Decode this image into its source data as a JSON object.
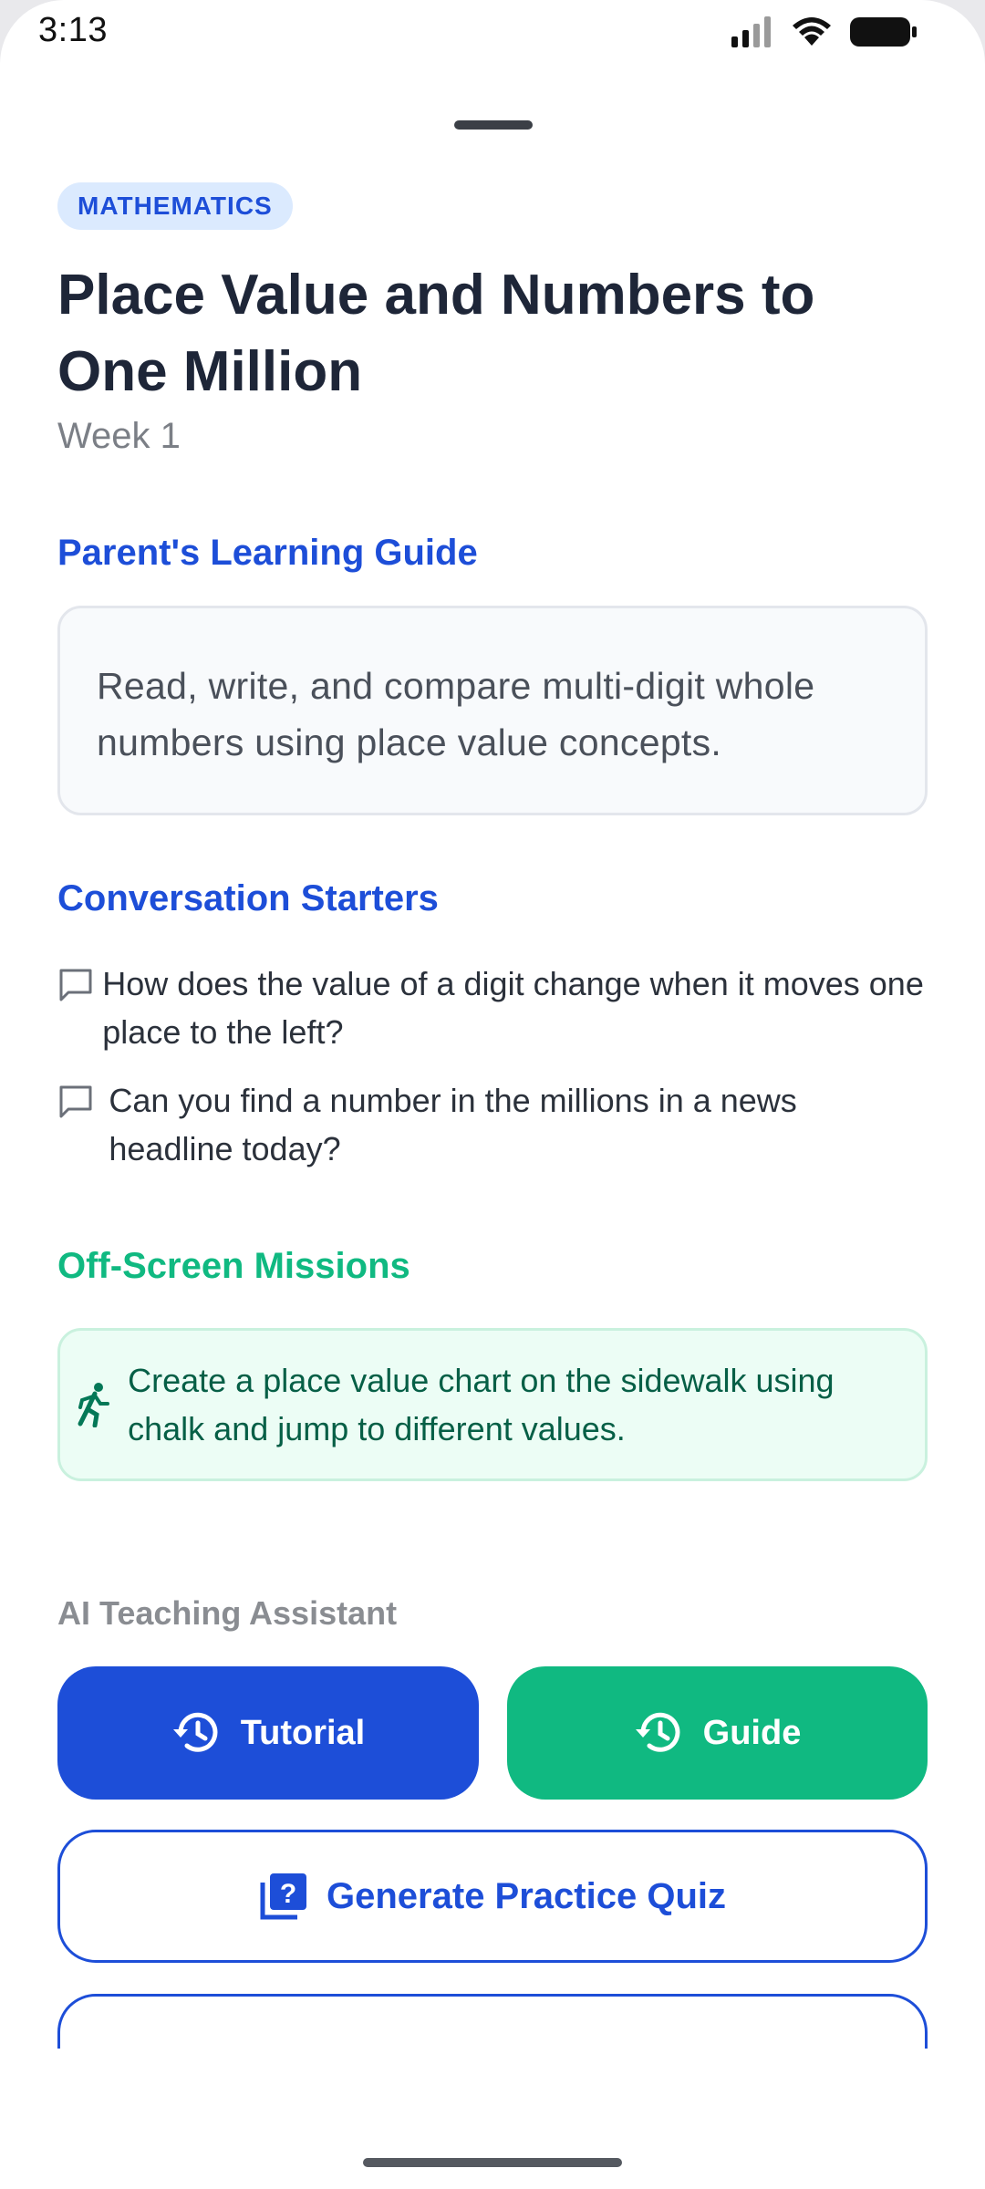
{
  "status_bar": {
    "time": "3:13",
    "icons": [
      "signal-icon",
      "wifi-icon",
      "battery-icon"
    ]
  },
  "header": {
    "subject": "MATHEMATICS",
    "title": "Place Value and Numbers to One Million",
    "week": "Week 1"
  },
  "learning_guide": {
    "heading": "Parent's Learning Guide",
    "text": "Read, write, and compare multi-digit whole numbers using place value concepts."
  },
  "conversation_starters": {
    "heading": "Conversation Starters",
    "items": [
      "How does the value of a digit change when it moves one place to the left?",
      "Can you find a number in the millions in a news headline today?"
    ]
  },
  "missions": {
    "heading": "Off-Screen Missions",
    "items": [
      "Create a place value chart on the sidewalk using chalk and jump to different values."
    ]
  },
  "assistant": {
    "label": "AI Teaching Assistant",
    "tutorial_label": "Tutorial",
    "guide_label": "Guide",
    "quiz_label": "Generate Practice Quiz"
  },
  "colors": {
    "primary_blue": "#1d4ed8",
    "accent_green": "#10b981",
    "title_dark": "#1e2638"
  }
}
